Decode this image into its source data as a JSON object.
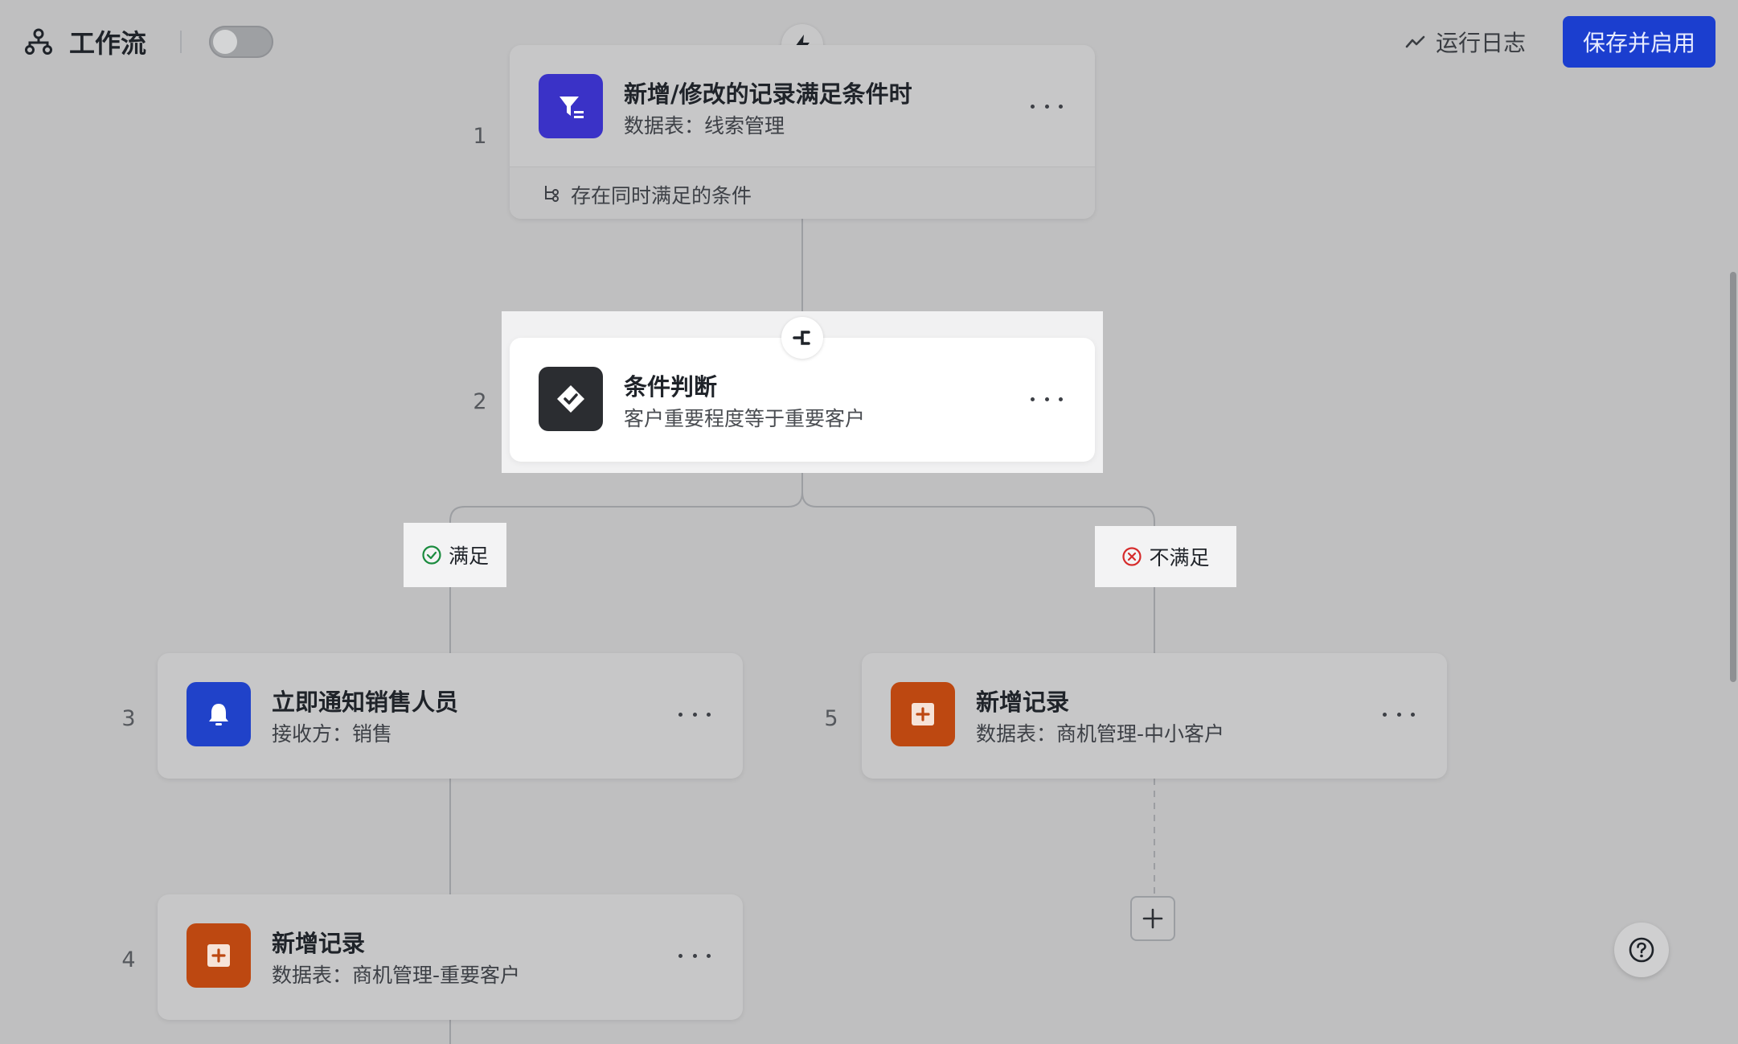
{
  "header": {
    "title": "工作流",
    "run_log": "运行日志",
    "save_button": "保存并启用"
  },
  "colors": {
    "primary": "#1b3ecf",
    "trigger_icon": "#3a32c7",
    "condition_icon": "#2b2d31",
    "notify_icon": "#2042c9",
    "record_icon": "#bd4811",
    "success": "#1a8b3e",
    "fail": "#d62b2b"
  },
  "nodes": [
    {
      "step": "1",
      "title": "新增/修改的记录满足条件时",
      "subtitle": "数据表：线索管理",
      "icon": "filter-icon",
      "footer": "存在同时满足的条件"
    },
    {
      "step": "2",
      "title": "条件判断",
      "subtitle": "客户重要程度等于重要客户",
      "icon": "check-diamond-icon"
    },
    {
      "step": "3",
      "title": "立即通知销售人员",
      "subtitle": "接收方：销售",
      "icon": "bell-icon"
    },
    {
      "step": "4",
      "title": "新增记录",
      "subtitle": "数据表：商机管理-重要客户",
      "icon": "add-record-icon"
    },
    {
      "step": "5",
      "title": "新增记录",
      "subtitle": "数据表：商机管理-中小客户",
      "icon": "add-record-icon"
    }
  ],
  "branches": {
    "yes": "满足",
    "no": "不满足"
  }
}
